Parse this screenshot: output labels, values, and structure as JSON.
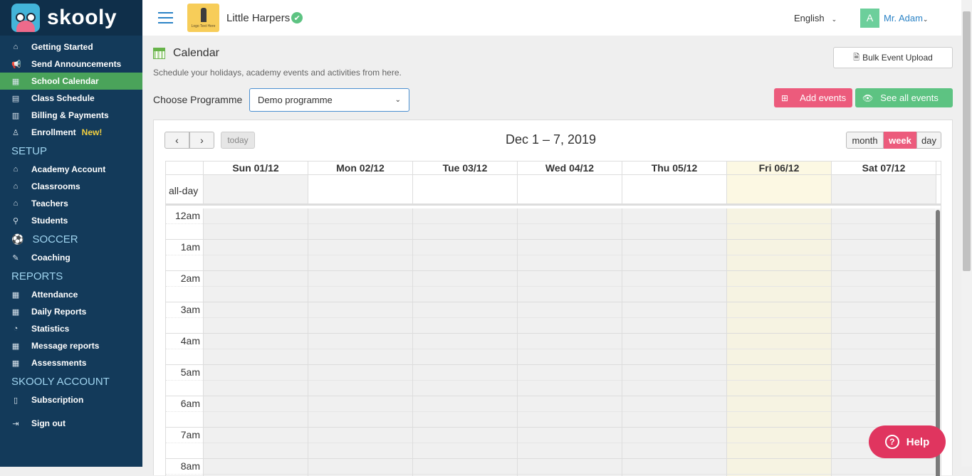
{
  "app": {
    "brand": "skooly"
  },
  "sidebar": {
    "groups": [
      {
        "items": [
          {
            "icon": "home-icon",
            "glyph": "⌂",
            "label": "Getting Started"
          },
          {
            "icon": "megaphone-icon",
            "glyph": "📢",
            "label": "Send Announcements"
          },
          {
            "icon": "calendar-icon",
            "glyph": "▦",
            "label": "School Calendar",
            "active": true
          },
          {
            "icon": "schedule-icon",
            "glyph": "▤",
            "label": "Class Schedule"
          },
          {
            "icon": "billing-icon",
            "glyph": "▥",
            "label": "Billing & Payments"
          },
          {
            "icon": "enroll-icon",
            "glyph": "♙",
            "label": "Enrollment",
            "badge": "New!"
          }
        ]
      },
      {
        "title": "SETUP",
        "items": [
          {
            "icon": "academy-icon",
            "glyph": "⌂",
            "label": "Academy Account"
          },
          {
            "icon": "classroom-icon",
            "glyph": "⌂",
            "label": "Classrooms"
          },
          {
            "icon": "teacher-icon",
            "glyph": "⌂",
            "label": "Teachers"
          },
          {
            "icon": "student-icon",
            "glyph": "⚲",
            "label": "Students"
          }
        ]
      },
      {
        "title": "SOCCER",
        "title_icon": "soccer-ball-icon",
        "items": [
          {
            "icon": "coaching-icon",
            "glyph": "✎",
            "label": "Coaching"
          }
        ]
      },
      {
        "title": "REPORTS",
        "items": [
          {
            "icon": "attendance-icon",
            "glyph": "▦",
            "label": "Attendance"
          },
          {
            "icon": "daily-reports-icon",
            "glyph": "▦",
            "label": "Daily Reports"
          },
          {
            "icon": "statistics-icon",
            "glyph": "◔",
            "label": "Statistics"
          },
          {
            "icon": "message-reports-icon",
            "glyph": "▦",
            "label": "Message reports"
          },
          {
            "icon": "assessments-icon",
            "glyph": "▦",
            "label": "Assessments"
          }
        ]
      },
      {
        "title": "SKOOLY ACCOUNT",
        "items": [
          {
            "icon": "subscription-icon",
            "glyph": "▯",
            "label": "Subscription"
          },
          {
            "icon": "sign-out-icon",
            "glyph": "⇥",
            "label": "Sign out"
          }
        ]
      }
    ]
  },
  "topbar": {
    "school_logo_text": "Logo Text Here",
    "school_name": "Little Harpers",
    "language": "English",
    "avatar_letter": "A",
    "user_name": "Mr. Adam"
  },
  "page": {
    "title": "Calendar",
    "subtitle": "Schedule your holidays, academy events and activities from here.",
    "bulk_upload_label": "Bulk Event Upload",
    "programme_label": "Choose Programme",
    "programme_value": "Demo programme",
    "add_events_label": "Add events",
    "see_all_events_label": "See all events"
  },
  "calendar": {
    "range_title": "Dec 1 – 7, 2019",
    "today_label": "today",
    "views": [
      "month",
      "week",
      "day"
    ],
    "active_view": "week",
    "allday_label": "all-day",
    "days": [
      "Sun 01/12",
      "Mon 02/12",
      "Tue 03/12",
      "Wed 04/12",
      "Thu 05/12",
      "Fri 06/12",
      "Sat 07/12"
    ],
    "today_index": 5,
    "hours": [
      "12am",
      "1am",
      "2am",
      "3am",
      "4am",
      "5am",
      "6am",
      "7am",
      "8am"
    ]
  },
  "help": {
    "label": "Help"
  },
  "colors": {
    "sidebar": "#133a5a",
    "active": "#4aa35a",
    "pink": "#ec5b7c",
    "green": "#5dc382",
    "today": "#fcf8e3"
  }
}
